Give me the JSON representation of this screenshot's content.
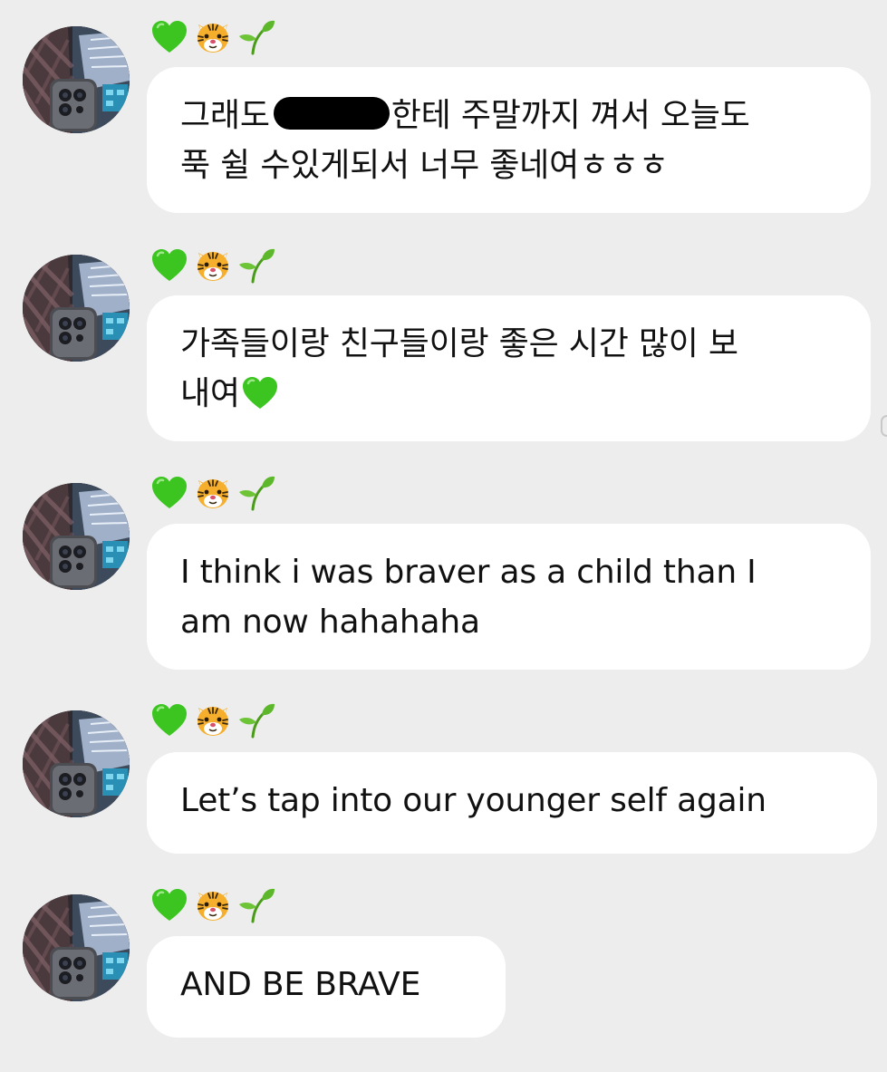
{
  "sender": {
    "name_icons": [
      "green-heart-icon",
      "tiger-face-icon",
      "seedling-icon"
    ]
  },
  "messages": [
    {
      "line1_before_redaction": "그래도",
      "line1_after_redaction": "한테 주말까지 껴서 오늘도",
      "line2": "푹 쉴 수있게되서 너무 좋네여ㅎㅎㅎ"
    },
    {
      "line1": "가족들이랑 친구들이랑 좋은 시간 많이 보",
      "line2": "내여",
      "trailing_icon": "green-heart-icon"
    },
    {
      "line1": "I think i was braver as a child than I",
      "line2": "am now hahahaha"
    },
    {
      "line1": "Let’s tap into our younger self again"
    },
    {
      "line1": "AND BE BRAVE"
    }
  ],
  "colors": {
    "background": "#ededed",
    "bubble": "#ffffff",
    "text": "#111111",
    "heart": "#3fc423",
    "tiger": "#f5a623"
  }
}
